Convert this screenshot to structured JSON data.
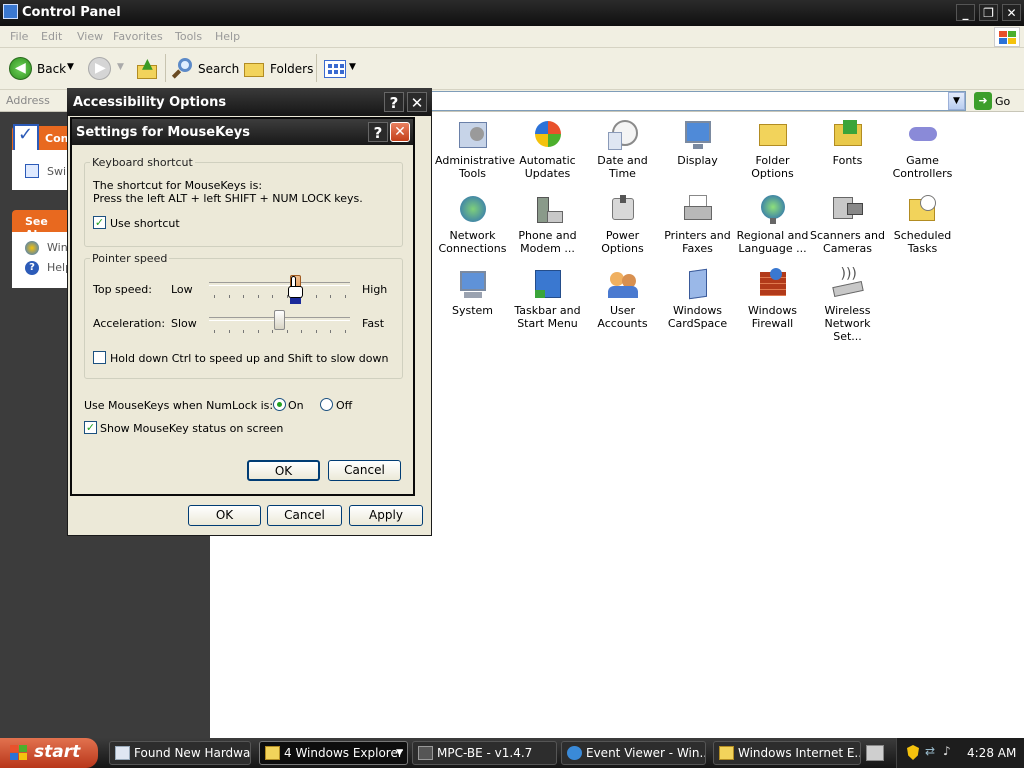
{
  "window": {
    "title": "Control Panel"
  },
  "menu": [
    "File",
    "Edit",
    "View",
    "Favorites",
    "Tools",
    "Help"
  ],
  "toolbar": {
    "back": "Back",
    "search": "Search",
    "folders": "Folders"
  },
  "address": {
    "label": "Address",
    "go": "Go"
  },
  "left_pane": {
    "section1_title": "Cont",
    "switch_label": "Swi",
    "see_also_title": "See Als",
    "link1": "Win",
    "link2": "Help"
  },
  "control_panel_items": [
    [
      "Administrative",
      "Tools"
    ],
    [
      "Automatic",
      "Updates"
    ],
    [
      "Date and Time",
      ""
    ],
    [
      "Display",
      ""
    ],
    [
      "Folder Options",
      ""
    ],
    [
      "Fonts",
      ""
    ],
    [
      "Game",
      "Controllers"
    ],
    [
      "Network",
      "Connections"
    ],
    [
      "Phone and",
      "Modem ..."
    ],
    [
      "Power Options",
      ""
    ],
    [
      "Printers and",
      "Faxes"
    ],
    [
      "Regional and",
      "Language ..."
    ],
    [
      "Scanners and",
      "Cameras"
    ],
    [
      "Scheduled",
      "Tasks"
    ],
    [
      "System",
      ""
    ],
    [
      "Taskbar and",
      "Start Menu"
    ],
    [
      "User Accounts",
      ""
    ],
    [
      "Windows",
      "CardSpace"
    ],
    [
      "Windows",
      "Firewall"
    ],
    [
      "Wireless",
      "Network Set..."
    ]
  ],
  "accessibility_dialog": {
    "title": "Accessibility Options",
    "ok": "OK",
    "cancel": "Cancel",
    "apply": "Apply"
  },
  "mousekeys_dialog": {
    "title": "Settings for MouseKeys",
    "keyboard_group": "Keyboard shortcut",
    "shortcut_line1": "The shortcut for MouseKeys is:",
    "shortcut_line2": "Press the left ALT + left SHIFT + NUM LOCK keys.",
    "use_shortcut": "Use shortcut",
    "use_shortcut_checked": true,
    "pointer_group": "Pointer speed",
    "top_speed_label": "Top speed:",
    "low": "Low",
    "high": "High",
    "acceleration_label": "Acceleration:",
    "slow": "Slow",
    "fast": "Fast",
    "top_speed_value": 0.62,
    "acceleration_value": 0.5,
    "hold_ctrl": "Hold down Ctrl to speed up and Shift to slow down",
    "hold_ctrl_checked": false,
    "numlock_label": "Use MouseKeys when NumLock is:",
    "on": "On",
    "off": "Off",
    "numlock_on_selected": true,
    "show_status": "Show MouseKey status on screen",
    "show_status_checked": true,
    "ok": "OK",
    "cancel": "Cancel"
  },
  "taskbar": {
    "start": "start",
    "tasks": [
      "Found New Hardwa...",
      "4 Windows Explorer",
      "MPC-BE - v1.4.7",
      "Event Viewer - Win...",
      "Windows Internet E..."
    ],
    "clock": "4:28 AM"
  },
  "colors": {
    "accent_green": "#21a121",
    "title_dark": "#161616",
    "start_orange": "#c4401a"
  }
}
